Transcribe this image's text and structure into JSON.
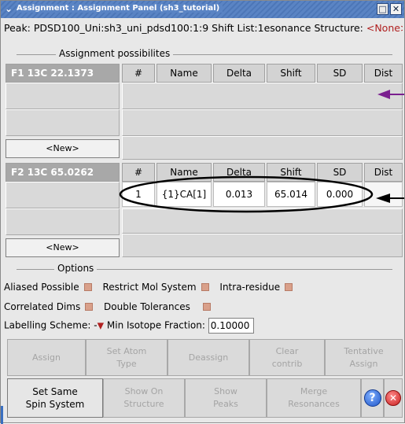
{
  "window": {
    "title": "Assignment : Assignment Panel (sh3_tutorial)",
    "max_icon": "□",
    "close_icon": "✕"
  },
  "peak": {
    "label": "Peak:",
    "value": "PDSD100_Uni:sh3_uni_pdsd100:1:9",
    "shiftlist_label": "Shift List:",
    "shiftlist_value": "1esonance",
    "structure_label": "Structure:",
    "structure_value": "<None>"
  },
  "sections": {
    "assignment_possibilities": "Assignment possibilites",
    "options": "Options"
  },
  "f1": {
    "header": "F1 13C  22.1373",
    "columns": [
      "#",
      "Name",
      "Delta",
      "Shift",
      "SD",
      "Dist"
    ],
    "new_label": "<New>"
  },
  "f2": {
    "header": "F2 13C  65.0262",
    "columns": [
      "#",
      "Name",
      "Delta",
      "Shift",
      "SD",
      "Dist"
    ],
    "rows": [
      {
        "num": "1",
        "name": "{1}CA[1]",
        "delta": "0.013",
        "shift": "65.014",
        "sd": "0.000",
        "dist": ""
      }
    ],
    "new_label": "<New>"
  },
  "options": {
    "aliased_possible": "Aliased Possible",
    "restrict_mol_system": "Restrict Mol System",
    "intra_residue": "Intra-residue",
    "correlated_dims": "Correlated Dims",
    "double_tolerances": "Double Tolerances",
    "labelling_scheme_label": "Labelling Scheme:",
    "labelling_scheme_value": "-",
    "min_isotope_label": "Min Isotope Fraction:",
    "min_isotope_value": "0.10000"
  },
  "buttons_row1": {
    "assign": "Assign",
    "set_atom_type": "Set Atom Type",
    "deassign": "Deassign",
    "clear_contrib": "Clear contrib",
    "tentative_assign": "Tentative Assign"
  },
  "buttons_row2": {
    "set_same_spin_system": "Set Same Spin System",
    "show_on_structure": "Show On Structure",
    "show_peaks": "Show Peaks",
    "merge_resonances": "Merge Resonances",
    "help": "?",
    "close": "✕"
  },
  "colors": {
    "arrow_purple": "#7a1f8f",
    "arrow_black": "#000000",
    "title_bar": "#5a84c4",
    "checkbox": "#d9a08a",
    "none_text": "#b02020"
  }
}
